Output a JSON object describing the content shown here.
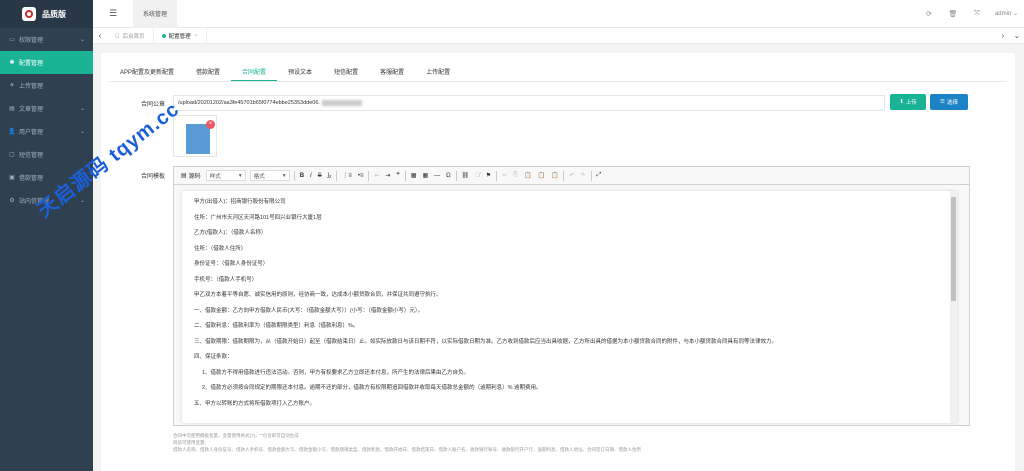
{
  "brand": {
    "title": "品质版"
  },
  "sidebar": {
    "items": [
      {
        "icon": "▭",
        "label": "权限管理",
        "arrow": "⌄",
        "active": false
      },
      {
        "icon": "✱",
        "label": "配置管理",
        "arrow": "",
        "active": true
      },
      {
        "icon": "✈",
        "label": "上传管理",
        "arrow": "",
        "active": false
      },
      {
        "icon": "▤",
        "label": "文章管理",
        "arrow": "⌄",
        "active": false
      },
      {
        "icon": "👤",
        "label": "用户管理",
        "arrow": "⌄",
        "active": false
      },
      {
        "icon": "▢",
        "label": "短信管理",
        "arrow": "",
        "active": false
      },
      {
        "icon": "▣",
        "label": "借款管理",
        "arrow": "",
        "active": false
      },
      {
        "icon": "⚙",
        "label": "站内信管理",
        "arrow": "⌄",
        "active": false
      }
    ]
  },
  "topbar": {
    "toggle": "☰",
    "tab": "系统管理",
    "user": "admin ⌄"
  },
  "tabsbar": {
    "prev": "‹",
    "next": "›",
    "home": "后台首页",
    "current": "配置管理",
    "close": "×",
    "expand": "⌄"
  },
  "config_tabs": [
    "APP配置及更新配置",
    "借款配置",
    "合同配置",
    "预设文本",
    "短信配置",
    "客服配置",
    "上传配置"
  ],
  "form": {
    "seal_label": "合同公章",
    "seal_value": "/upload/20201202/aa3fe45701b65f0774ebbe25353dde06.",
    "upload_label": "上传",
    "choose_label": "选择",
    "remove_badge": "×",
    "template_label": "合同模板"
  },
  "toolbar": {
    "source": "源码",
    "style": "样式",
    "format": "格式",
    "bold": "B",
    "italic": "I",
    "strike": "S",
    "clear": "I̲ₓ",
    "ol": "⋮≡",
    "ul": "•≡",
    "outdent": "⇤",
    "indent": "⇥",
    "quote": "❞",
    "image": "▦",
    "table": "▦",
    "hr": "―",
    "omega": "Ω",
    "link": "⛓",
    "unlink": "⛓̸",
    "anchor": "⚑",
    "cut": "✂",
    "copy": "⎘",
    "paste": "📋",
    "paste_text": "📋",
    "paste_word": "📋",
    "undo": "↶",
    "redo": "↷",
    "maximize": "⤢"
  },
  "contract": [
    "甲方(出借人)：招商银行股份有限公司",
    "住所：广州市天河区天河路101号四兴业银行大厦1层",
    "乙方(借款人)：（借款人名称）",
    "住所：（借款人住所）",
    "身份证号：（借款人身份证号）",
    "手机号：（借款人手机号）",
    "甲乙双方本着平等自愿、诚实信用的原则，经协商一致，达成本小额贷款合同，并保证共同遵守执行。",
    "一、借款金额：乙方向甲方借款人民币(大写：（借款金额大写））(小写：（借款金额小写）元）。",
    "二、借款利息：借款利率为（借款期限类型）利息（借款利息）%。",
    "三、借款期限：借款期限为，从（借款开始日）起至（借款结束日）止。如实际放款日与该日期不符，以实际借款日期为准。乙方收到借款后应当出具收据，乙方所出具的借据为本小额贷款合同的附件，与本小额贷款合同具有同等法律效力。",
    "四、保证条款：",
    "1、借款方不得用借款进行违法活动。否则，甲方有权要求乙方立即还本付息，所产生的法律后果由乙方自负。",
    "2、借款方必须按合同规定的期限还本付息。逾期不还的部分，借款方有权限期追回借款并收取每天借款总金额的（逾期利息）% 逾期费用。",
    "五、甲方以转账的方式将所借款项打入乙方账户。"
  ],
  "help": {
    "line1": "合同中可使用模板变量，变量使用格式{?}，\"\"包含即可自动生成",
    "line2": "目前可使用变量：",
    "line3": "借款人名称、借款人身份证号、借款人手机号、借款金额大写、借款金额小写、借款期限类型、借款利息、借款开始日、借款结束日、借款人账户名、收款银行账号、收款银行开户行、逾期利息、借款人地址、合同签订日期、借款人住所"
  },
  "watermark": "天启源码 tqym.cc"
}
